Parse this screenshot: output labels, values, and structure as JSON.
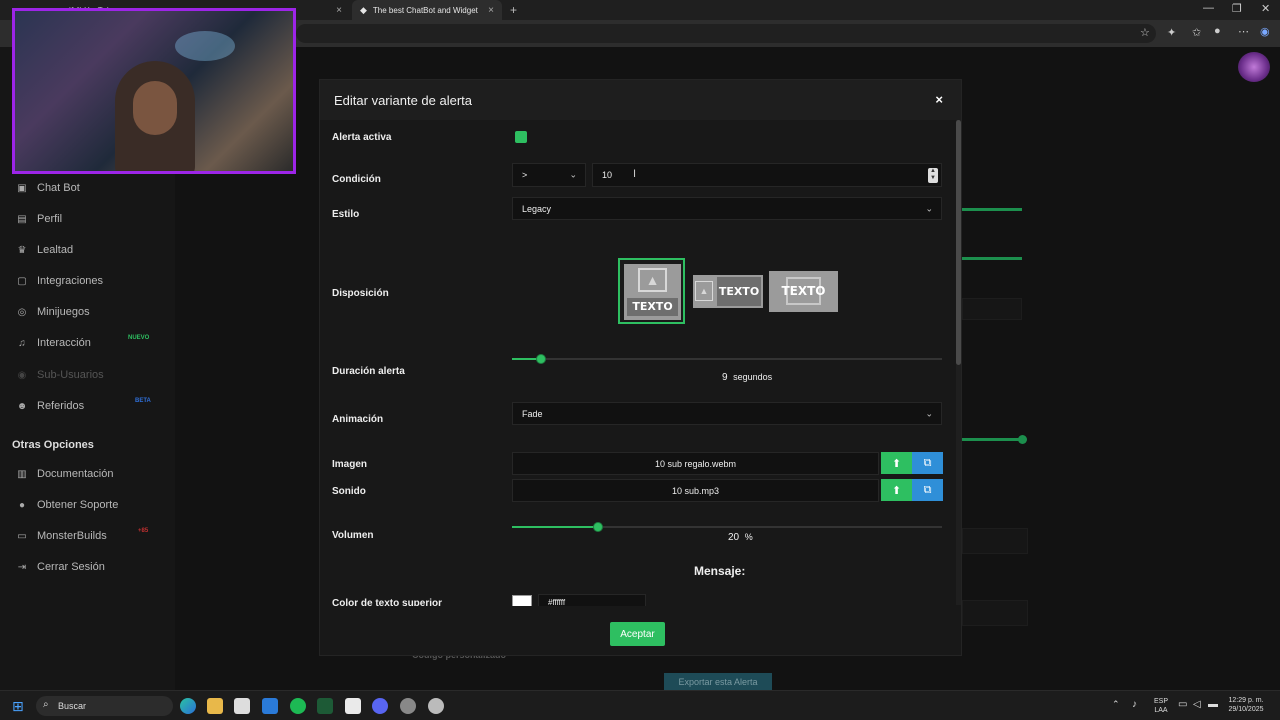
{
  "browser": {
    "tabs": [
      {
        "label": "(14) YouTube",
        "active": false
      },
      {
        "label": "The best ChatBot and Widgets fo",
        "active": true
      }
    ],
    "new_tab": "+",
    "close_tab": "×"
  },
  "sidebar": {
    "items": [
      {
        "label": "Chat Bot",
        "icon": "robot-icon"
      },
      {
        "label": "Perfil",
        "icon": "id-card-icon"
      },
      {
        "label": "Lealtad",
        "icon": "trophy-icon"
      },
      {
        "label": "Integraciones",
        "icon": "plug-icon"
      },
      {
        "label": "Minijuegos",
        "icon": "gamepad-icon"
      },
      {
        "label": "Interacción",
        "icon": "music-note-icon",
        "badge": "NUEVO"
      },
      {
        "label": "Sub-Usuarios",
        "icon": "users-icon",
        "dim": true
      },
      {
        "label": "Referidos",
        "icon": "user-group-icon",
        "badge": "BETA"
      }
    ],
    "section_title": "Otras Opciones",
    "other_items": [
      {
        "label": "Documentación",
        "icon": "book-icon"
      },
      {
        "label": "Obtener Soporte",
        "icon": "support-icon"
      },
      {
        "label": "MonsterBuilds",
        "icon": "monitor-icon",
        "badge": "+85"
      },
      {
        "label": "Cerrar Sesión",
        "icon": "logout-icon"
      }
    ]
  },
  "background": {
    "codigo": "Código personalizado",
    "exportar": "Exportar esta Alerta"
  },
  "modal": {
    "title": "Editar variante de alerta",
    "close": "×",
    "alerta_activa": {
      "label": "Alerta activa",
      "checked": true
    },
    "condicion": {
      "label": "Condición",
      "operator": ">",
      "value": "10"
    },
    "estilo": {
      "label": "Estilo",
      "value": "Legacy"
    },
    "disposicion": {
      "label": "Disposición",
      "options": [
        "TEXTO",
        "TEXTO",
        "TEXTO"
      ],
      "selected": 0
    },
    "duracion": {
      "label": "Duración alerta",
      "value": "9",
      "unit": "segundos",
      "fraction": 0.068
    },
    "animacion": {
      "label": "Animación",
      "value": "Fade"
    },
    "imagen": {
      "label": "Imagen",
      "file": "10 sub regalo.webm"
    },
    "sonido": {
      "label": "Sonido",
      "file": "10 sub.mp3"
    },
    "volumen": {
      "label": "Volumen",
      "value": "20",
      "unit": "%",
      "fraction": 0.2
    },
    "mensaje": "Mensaje:",
    "color_texto": {
      "label": "Color de texto superior",
      "value": "#ffffff"
    },
    "accept": "Aceptar"
  },
  "taskbar": {
    "search": "Buscar",
    "lang": "ESP",
    "lang2": "LAA",
    "time": "12:29 p. m.",
    "date": "29/10/2025"
  },
  "colors": {
    "accent": "#2ebf61",
    "blue": "#2f8fd8",
    "webcam_border": "#9d25e8"
  }
}
